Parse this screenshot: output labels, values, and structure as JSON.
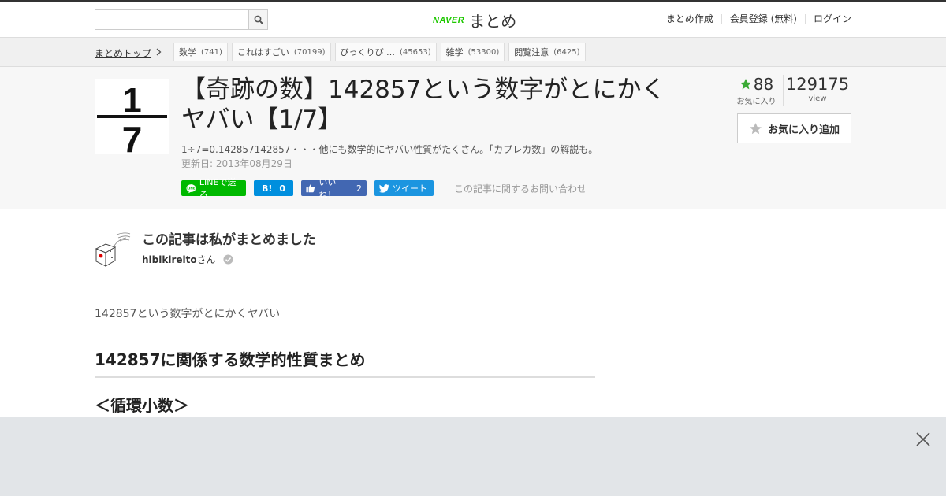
{
  "header": {
    "search_placeholder": "",
    "logo_brand": "NAVER",
    "logo_text": "まとめ",
    "nav": [
      "まとめ作成",
      "会員登録 (無料)",
      "ログイン"
    ]
  },
  "breadcrumb": {
    "top_label": "まとめトップ",
    "tags": [
      {
        "label": "数学",
        "count": "(741)"
      },
      {
        "label": "これはすごい",
        "count": "(70199)"
      },
      {
        "label": "びっくりぴ …",
        "count": "(45653)"
      },
      {
        "label": "雑学",
        "count": "(53300)"
      },
      {
        "label": "閲覧注意",
        "count": "(6425)"
      }
    ]
  },
  "article": {
    "title": "【奇跡の数】142857という数字がとにかくヤバい【1/7】",
    "subtitle": "1÷7=0.142857142857・・・他にも数学的にヤバい性質がたくさん。「カプレカ数」の解説も。",
    "updated": "更新日: 2013年08月29日",
    "thumb_numerator": "1",
    "thumb_denominator": "7",
    "favorites_count": "88",
    "favorites_label": "お気に入り",
    "views_count": "129175",
    "views_label": "view",
    "add_favorite_label": "お気に入り追加"
  },
  "share": {
    "line_label": "LINEで送る",
    "hatena_label": "B!",
    "hatena_count": "0",
    "fb_label": "いいね！",
    "fb_count": "2",
    "tweet_label": "ツイート",
    "inquiry_label": "この記事に関するお問い合わせ"
  },
  "author": {
    "heading": "この記事は私がまとめました",
    "username": "hibikireito",
    "suffix": "さん"
  },
  "content": {
    "lead": "142857という数字がとにかくヤバい",
    "section_title": "142857に関係する数学的性質まとめ",
    "sub_title": "＜循環小数＞"
  },
  "colors": {
    "line_green": "#00b900",
    "hatena_blue": "#008fde",
    "fb_blue": "#4267b2",
    "twitter_blue": "#1b95e0",
    "naver_green": "#1ec800",
    "star_green": "#3aaa35"
  }
}
